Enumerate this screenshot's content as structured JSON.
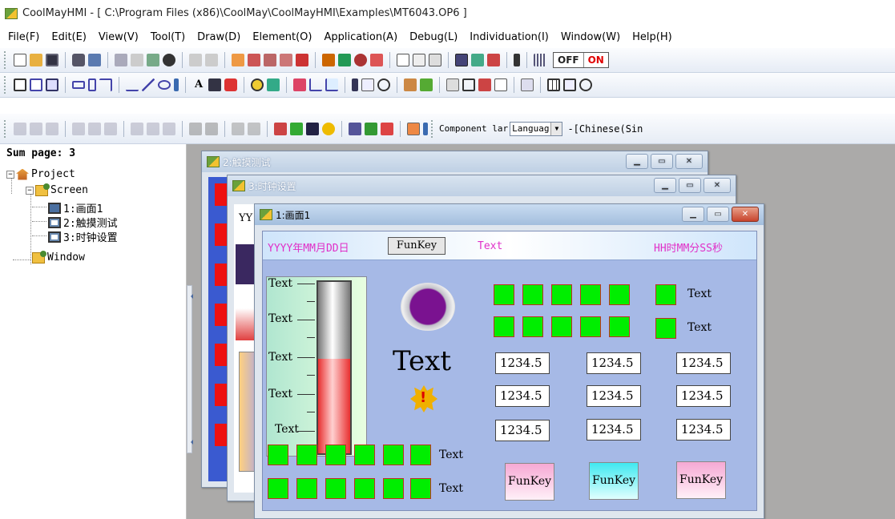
{
  "window": {
    "title": "CoolMayHMI - [ C:\\Program Files (x86)\\CoolMay\\CoolMayHMI\\Examples\\MT6043.OP6 ]"
  },
  "menu": [
    "File(F)",
    "Edit(E)",
    "View(V)",
    "Tool(T)",
    "Draw(D)",
    "Element(O)",
    "Application(A)",
    "Debug(L)",
    "Individuation(I)",
    "Window(W)",
    "Help(H)"
  ],
  "toolbar1": {
    "off_label": "OFF",
    "on_label": "ON"
  },
  "toolbar3": {
    "component_label": "Component lar",
    "language_value": "Languag",
    "language_current": "-[Chinese(Sin"
  },
  "project_tree": {
    "sum_page": "Sum page: 3",
    "root": "Project",
    "screen_folder": "Screen",
    "screens": [
      "1:画面1",
      "2:触摸测试",
      "3:时钟设置"
    ],
    "window_folder": "Window"
  },
  "mdi": {
    "win2_title": "2:触摸测试",
    "win3_title": "3:时钟设置",
    "win3_partial": "YY",
    "win1_title": "1:画面1"
  },
  "hmi": {
    "date_text": "YYYY年MM月DD日",
    "funkey_top": "FunKey",
    "header_text": "Text",
    "time_text": "HH时MM分SS秒",
    "scale_labels": [
      "Text",
      "Text",
      "Text",
      "Text",
      "Text"
    ],
    "gauge_fill": 0.55,
    "big_text": "Text",
    "indicator_row1_label": "Text",
    "indicator_row2_label": "Text",
    "numeric_values": [
      "1234.5",
      "1234.5",
      "1234.5",
      "1234.5",
      "1234.5",
      "1234.5",
      "1234.5",
      "1234.5",
      "1234.5"
    ],
    "bottom_row1_label": "Text",
    "bottom_row2_label": "Text",
    "funkeys": [
      "FunKey",
      "FunKey",
      "FunKey"
    ]
  },
  "colors": {
    "indicator_green": "#00ee00",
    "indicator_border": "#c03020",
    "hmi_bg": "#a6b9e6",
    "pink_text": "#e030c8",
    "workarea": "#abaaa9"
  }
}
